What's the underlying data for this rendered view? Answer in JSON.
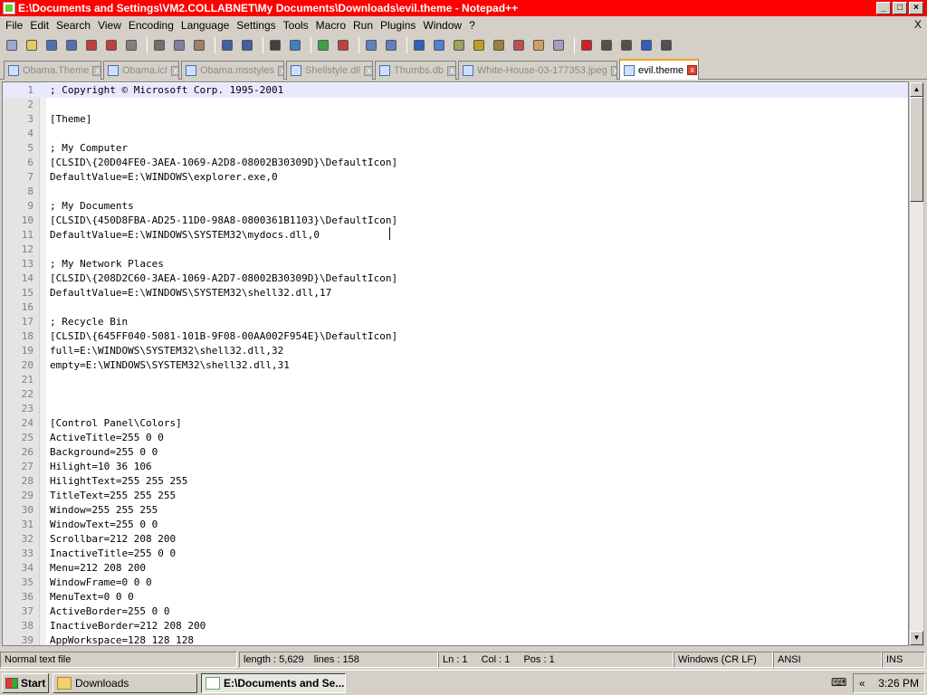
{
  "window": {
    "title": "E:\\Documents and Settings\\VM2.COLLABNET\\My Documents\\Downloads\\evil.theme - Notepad++",
    "min_glyph": "_",
    "max_glyph": "□",
    "close_glyph": "×"
  },
  "menu": {
    "items": [
      "File",
      "Edit",
      "Search",
      "View",
      "Encoding",
      "Language",
      "Settings",
      "Tools",
      "Macro",
      "Run",
      "Plugins",
      "Window",
      "?"
    ],
    "close_label": "X"
  },
  "toolbar": {
    "buttons": [
      "new-file-icon",
      "open-file-icon",
      "save-icon",
      "save-all-icon",
      "close-icon",
      "close-all-icon",
      "print-icon",
      "cut-icon",
      "copy-icon",
      "paste-icon",
      "undo-icon",
      "redo-icon",
      "find-icon",
      "replace-icon",
      "zoom-in-icon",
      "zoom-out-icon",
      "sync-v-icon",
      "sync-h-icon",
      "word-wrap-icon",
      "show-all-chars-icon",
      "indent-guide-icon",
      "udl-icon",
      "doc-map-icon",
      "function-list-icon",
      "folder-workspace-icon",
      "monitor-icon",
      "record-macro-icon",
      "stop-macro-icon",
      "play-macro-icon",
      "play-multi-icon",
      "save-macro-icon"
    ]
  },
  "tabs": [
    {
      "label": "Obama.Theme",
      "active": false
    },
    {
      "label": "Obama.icl",
      "active": false
    },
    {
      "label": "Obama.msstyles",
      "active": false
    },
    {
      "label": "Shellstyle.dll",
      "active": false
    },
    {
      "label": "Thumbs.db",
      "active": false
    },
    {
      "label": "White-House-03-177353.jpeg",
      "active": false
    },
    {
      "label": "evil.theme",
      "active": true
    }
  ],
  "editor": {
    "current_line": 1,
    "lines": [
      {
        "n": "1",
        "text": "; Copyright © Microsoft Corp. 1995-2001"
      },
      {
        "n": "2",
        "text": ""
      },
      {
        "n": "3",
        "text": "[Theme]"
      },
      {
        "n": "4",
        "text": ""
      },
      {
        "n": "5",
        "text": "; My Computer"
      },
      {
        "n": "6",
        "text": "[CLSID\\{20D04FE0-3AEA-1069-A2D8-08002B30309D}\\DefaultIcon]"
      },
      {
        "n": "7",
        "text": "DefaultValue=E:\\WINDOWS\\explorer.exe,0"
      },
      {
        "n": "8",
        "text": ""
      },
      {
        "n": "9",
        "text": "; My Documents"
      },
      {
        "n": "10",
        "text": "[CLSID\\{450D8FBA-AD25-11D0-98A8-0800361B1103}\\DefaultIcon]"
      },
      {
        "n": "11",
        "text": "DefaultValue=E:\\WINDOWS\\SYSTEM32\\mydocs.dll,0"
      },
      {
        "n": "12",
        "text": ""
      },
      {
        "n": "13",
        "text": "; My Network Places"
      },
      {
        "n": "14",
        "text": "[CLSID\\{208D2C60-3AEA-1069-A2D7-08002B30309D}\\DefaultIcon]"
      },
      {
        "n": "15",
        "text": "DefaultValue=E:\\WINDOWS\\SYSTEM32\\shell32.dll,17"
      },
      {
        "n": "16",
        "text": ""
      },
      {
        "n": "17",
        "text": "; Recycle Bin"
      },
      {
        "n": "18",
        "text": "[CLSID\\{645FF040-5081-101B-9F08-00AA002F954E}\\DefaultIcon]"
      },
      {
        "n": "19",
        "text": "full=E:\\WINDOWS\\SYSTEM32\\shell32.dll,32"
      },
      {
        "n": "20",
        "text": "empty=E:\\WINDOWS\\SYSTEM32\\shell32.dll,31"
      },
      {
        "n": "21",
        "text": ""
      },
      {
        "n": "22",
        "text": ""
      },
      {
        "n": "23",
        "text": ""
      },
      {
        "n": "24",
        "text": "[Control Panel\\Colors]"
      },
      {
        "n": "25",
        "text": "ActiveTitle=255 0 0"
      },
      {
        "n": "26",
        "text": "Background=255 0 0"
      },
      {
        "n": "27",
        "text": "Hilight=10 36 106"
      },
      {
        "n": "28",
        "text": "HilightText=255 255 255"
      },
      {
        "n": "29",
        "text": "TitleText=255 255 255"
      },
      {
        "n": "30",
        "text": "Window=255 255 255"
      },
      {
        "n": "31",
        "text": "WindowText=255 0 0"
      },
      {
        "n": "32",
        "text": "Scrollbar=212 208 200"
      },
      {
        "n": "33",
        "text": "InactiveTitle=255 0 0"
      },
      {
        "n": "34",
        "text": "Menu=212 208 200"
      },
      {
        "n": "35",
        "text": "WindowFrame=0 0 0"
      },
      {
        "n": "36",
        "text": "MenuText=0 0 0"
      },
      {
        "n": "37",
        "text": "ActiveBorder=255 0 0"
      },
      {
        "n": "38",
        "text": "InactiveBorder=212 208 200"
      },
      {
        "n": "39",
        "text": "AppWorkspace=128 128 128"
      }
    ]
  },
  "statusbar": {
    "file_type": "Normal text file",
    "length": "length : 5,629",
    "lines": "lines : 158",
    "ln": "Ln : 1",
    "col": "Col : 1",
    "pos": "Pos : 1",
    "eol": "Windows (CR LF)",
    "encoding": "ANSI",
    "mode": "INS"
  },
  "taskbar": {
    "start_label": "Start",
    "tasks": [
      {
        "label": "Downloads",
        "active": false
      },
      {
        "label": "E:\\Documents and Se...",
        "active": true
      }
    ],
    "tray_chevron": "«",
    "clock": "3:26 PM"
  },
  "colors": {
    "titlebar": "#ff0000",
    "current_line": "#e8e8ff",
    "active_tab_accent": "#f4a020"
  }
}
